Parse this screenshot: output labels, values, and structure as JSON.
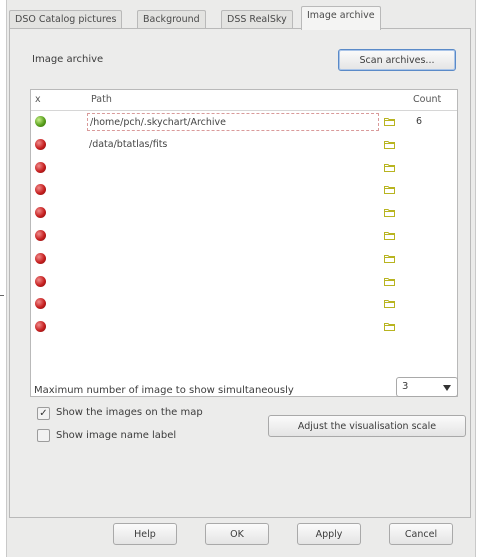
{
  "tabs": [
    "DSO Catalog pictures",
    "Background",
    "DSS RealSky",
    "Image archive"
  ],
  "active_tab": "Image archive",
  "section_label": "Image archive",
  "scan_button": "Scan archives...",
  "grid": {
    "headers": {
      "x": "x",
      "path": "Path",
      "count": "Count"
    },
    "rows": [
      {
        "status": "green",
        "path": "/home/pch/.skychart/Archive",
        "count": "6",
        "editing": true
      },
      {
        "status": "red",
        "path": "/data/btatlas/fits",
        "count": ""
      },
      {
        "status": "red",
        "path": "",
        "count": ""
      },
      {
        "status": "red",
        "path": "",
        "count": ""
      },
      {
        "status": "red",
        "path": "",
        "count": ""
      },
      {
        "status": "red",
        "path": "",
        "count": ""
      },
      {
        "status": "red",
        "path": "",
        "count": ""
      },
      {
        "status": "red",
        "path": "",
        "count": ""
      },
      {
        "status": "red",
        "path": "",
        "count": ""
      },
      {
        "status": "red",
        "path": "",
        "count": ""
      }
    ]
  },
  "max_images": {
    "label": "Maximum number of image to show simultaneously",
    "value": "3"
  },
  "show_images": {
    "label": "Show the images on the map",
    "checked": true,
    "mark": "✓"
  },
  "show_name": {
    "label": "Show image name label",
    "checked": false
  },
  "adjust_button": "Adjust the visualisation scale",
  "footer": {
    "help": "Help",
    "ok": "OK",
    "apply": "Apply",
    "cancel": "Cancel"
  },
  "icons": {
    "folder": "folder-icon",
    "dropdown": "chevron-down-icon",
    "status": "status-dot-icon"
  },
  "colors": {
    "status_ok": "#5aa01e",
    "status_missing": "#c62020",
    "folder": "#b8b420"
  }
}
